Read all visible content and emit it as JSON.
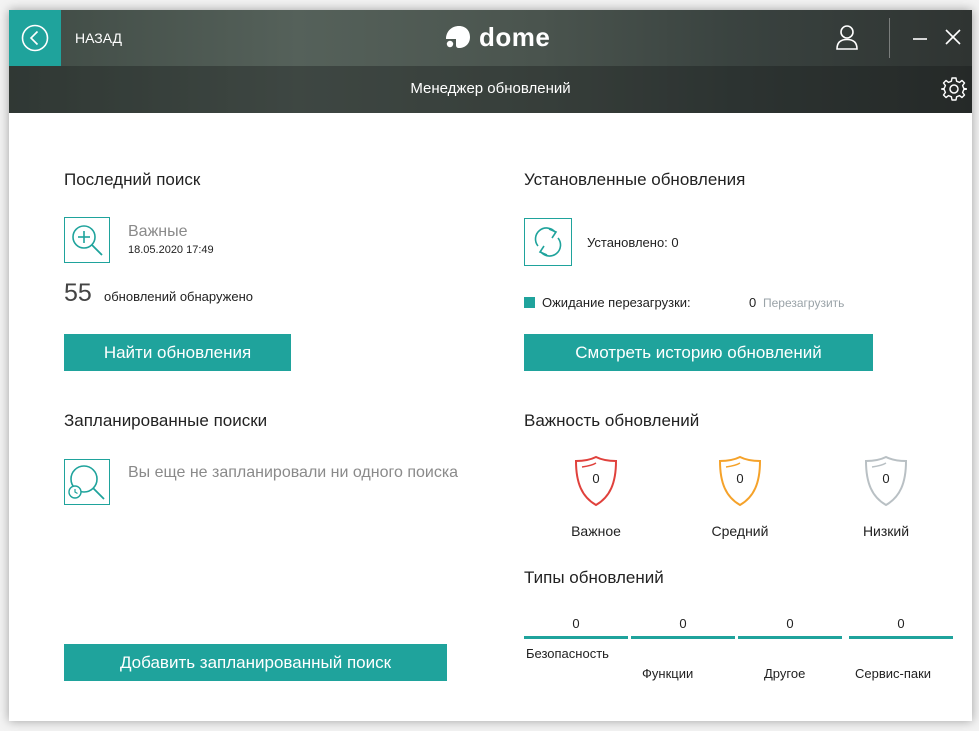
{
  "header": {
    "back_label": "НАЗАД",
    "logo_text": "dome",
    "page_title": "Менеджер обновлений"
  },
  "last_search": {
    "title": "Последний поиск",
    "type": "Важные",
    "date": "18.05.2020 17:49",
    "count": "55",
    "count_label": "обновлений обнаружено",
    "find_button": "Найти обновления"
  },
  "scheduled": {
    "title": "Запланированные поиски",
    "empty_text": "Вы еще не запланировали ни одного поиска",
    "add_button": "Добавить запланированный поиск"
  },
  "installed": {
    "title": "Установленные обновления",
    "installed_text": "Установлено: 0",
    "pending_label": "Ожидание перезагрузки:",
    "pending_value": "0",
    "restart_link": "Перезагрузить",
    "history_button": "Смотреть историю обновлений"
  },
  "severity": {
    "title": "Важность обновлений",
    "items": [
      {
        "label": "Важное",
        "value": "0",
        "color": "#e0413c"
      },
      {
        "label": "Средний",
        "value": "0",
        "color": "#f5a22a"
      },
      {
        "label": "Низкий",
        "value": "0",
        "color": "#b9c0c4"
      }
    ]
  },
  "types": {
    "title": "Типы обновлений",
    "items": [
      {
        "label": "Безопасность",
        "value": "0"
      },
      {
        "label": "Функции",
        "value": "0"
      },
      {
        "label": "Другое",
        "value": "0"
      },
      {
        "label": "Сервис-паки",
        "value": "0"
      }
    ]
  },
  "colors": {
    "accent": "#1fa39c",
    "critical": "#e0413c",
    "medium": "#f5a22a",
    "low": "#b9c0c4"
  }
}
